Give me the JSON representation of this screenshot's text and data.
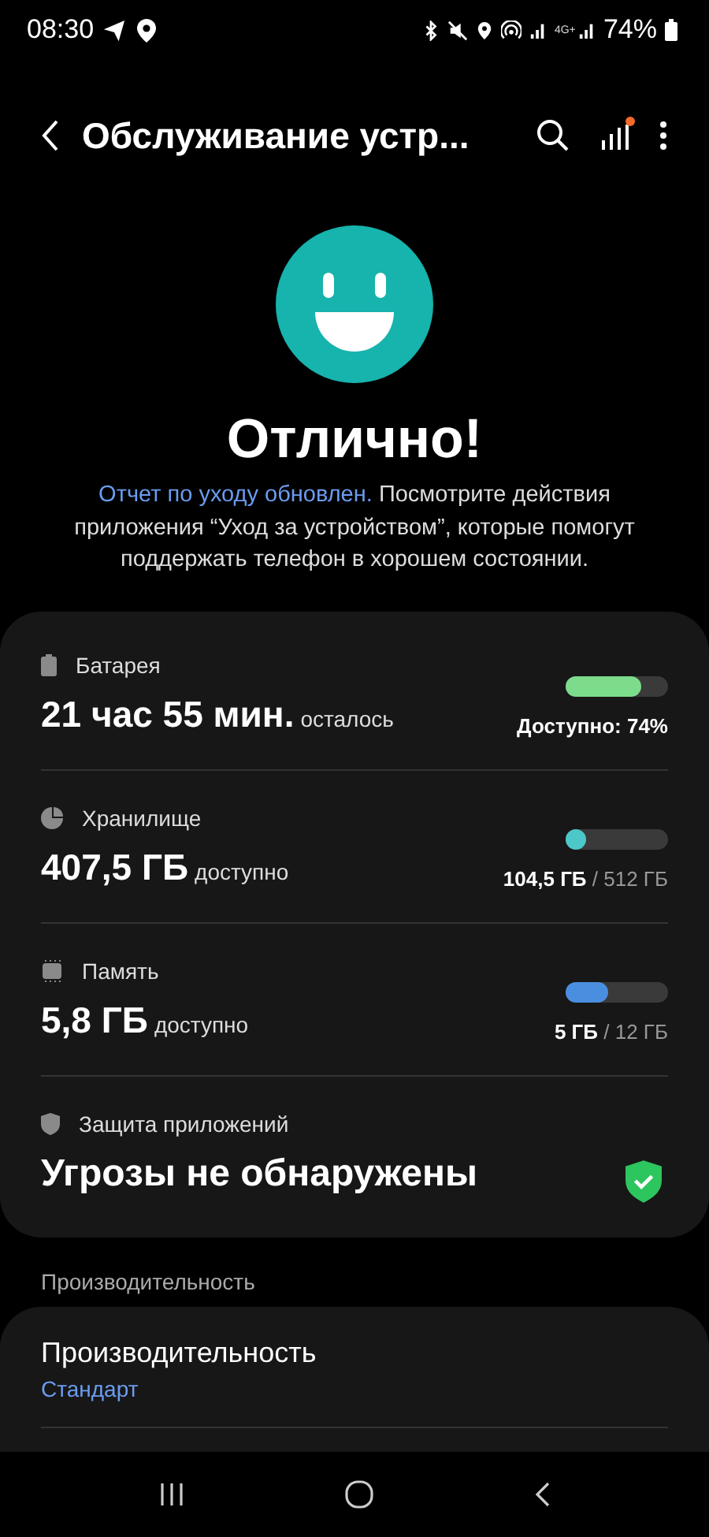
{
  "status_bar": {
    "time": "08:30",
    "network": "4G+",
    "battery": "74%"
  },
  "header": {
    "title": "Обслуживание устр...",
    "insights_badge": true
  },
  "hero": {
    "headline": "Отлично!",
    "link": "Отчет по уходу обновлен.",
    "message": " Посмотрите действия приложения “Уход за устройством”, которые помогут поддержать телефон в хорошем состоянии."
  },
  "stats": [
    {
      "kind": "battery",
      "label": "Батарея",
      "value": "21 час 55 мин.",
      "suffix": "осталось",
      "level": 0.74,
      "color": "#7ddc8c",
      "reading": "Доступно: 74%"
    },
    {
      "kind": "storage",
      "label": "Хранилище",
      "value": "407,5 ГБ",
      "suffix": "доступно",
      "level": 0.2,
      "color": "#4cc8c8",
      "used": "104,5 ГБ",
      "total": "/ 512 ГБ"
    },
    {
      "kind": "memory",
      "label": "Память",
      "value": "5,8 ГБ",
      "suffix": "доступно",
      "level": 0.42,
      "color": "#4a8ee0",
      "used": "5 ГБ",
      "total": "/ 12 ГБ"
    },
    {
      "kind": "protection",
      "label": "Защита приложений",
      "value": "Угрозы не обнаружены"
    }
  ],
  "section_title": "Производительность",
  "performance": {
    "title": "Производительность",
    "value": "Стандарт"
  }
}
